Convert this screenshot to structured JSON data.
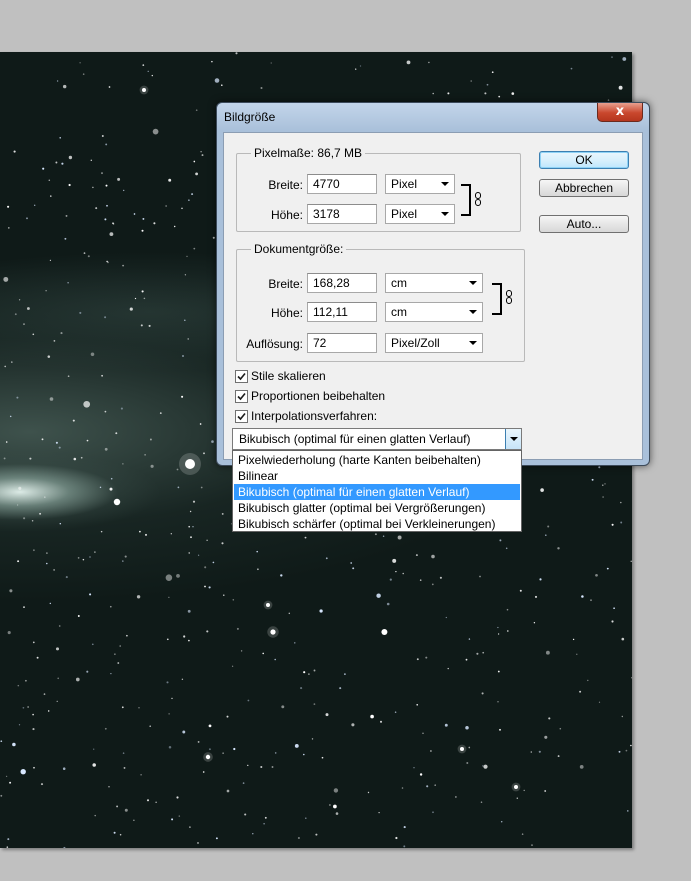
{
  "dialog": {
    "title": "Bildgröße",
    "close_label": "x",
    "buttons": {
      "ok": "OK",
      "cancel": "Abbrechen",
      "auto": "Auto..."
    }
  },
  "pixel_dimensions": {
    "legend": "Pixelmaße: 86,7 MB",
    "width_label": "Breite:",
    "width_value": "4770",
    "width_unit": "Pixel",
    "height_label": "Höhe:",
    "height_value": "3178",
    "height_unit": "Pixel"
  },
  "document_size": {
    "legend": "Dokumentgröße:",
    "width_label": "Breite:",
    "width_value": "168,28",
    "width_unit": "cm",
    "height_label": "Höhe:",
    "height_value": "112,11",
    "height_unit": "cm",
    "resolution_label": "Auflösung:",
    "resolution_value": "72",
    "resolution_unit": "Pixel/Zoll"
  },
  "options": {
    "scale_styles": {
      "label": "Stile skalieren",
      "checked": true
    },
    "constrain_proportions": {
      "label": "Proportionen beibehalten",
      "checked": true
    },
    "resample": {
      "label": "Interpolationsverfahren:",
      "checked": true
    }
  },
  "interpolation": {
    "selected": "Bikubisch (optimal für einen glatten Verlauf)",
    "items": [
      "Pixelwiederholung (harte Kanten beibehalten)",
      "Bilinear",
      "Bikubisch (optimal für einen glatten Verlauf)",
      "Bikubisch glatter (optimal bei Vergrößerungen)",
      "Bikubisch schärfer (optimal bei Verkleinerungen)"
    ],
    "selected_index": 2
  },
  "colors": {
    "accent": "#3399ff",
    "title_bar": "#a9c0da",
    "close": "#c9472d"
  }
}
